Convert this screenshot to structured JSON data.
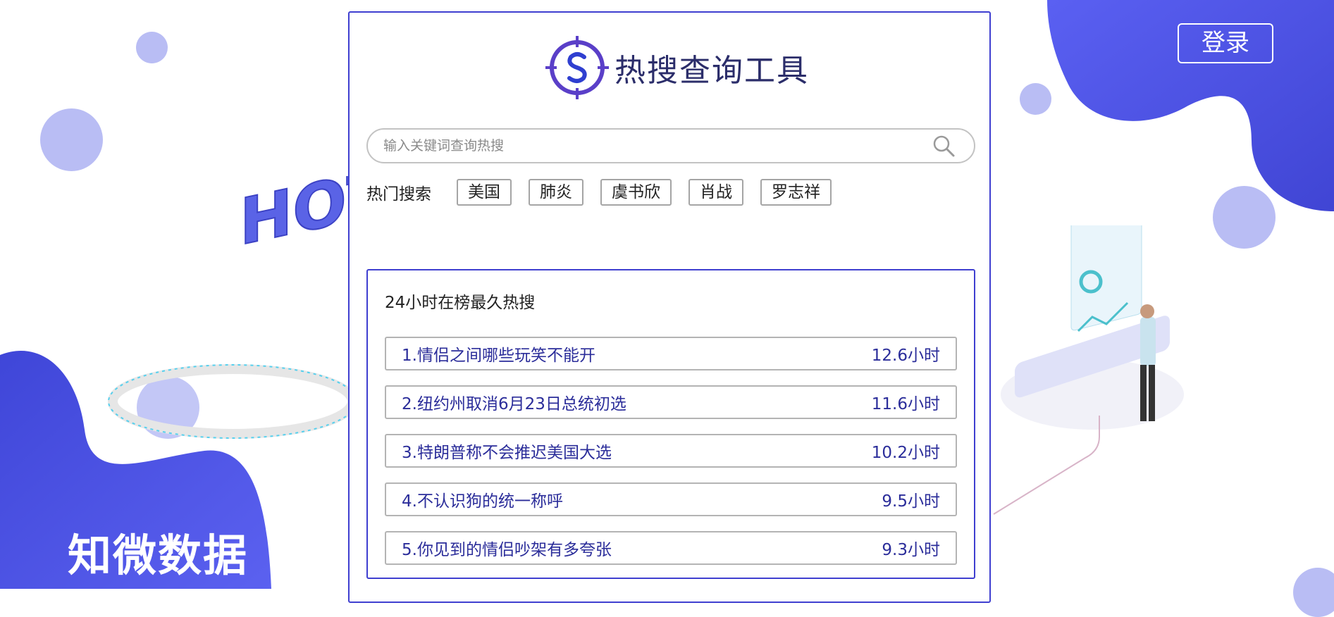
{
  "brand": {
    "name": "知微数据"
  },
  "header": {
    "login_label": "登录"
  },
  "logo": {
    "title": "热搜查询工具"
  },
  "search": {
    "placeholder": "输入关键词查询热搜"
  },
  "hot": {
    "label": "热门搜索",
    "tags": [
      "美国",
      "肺炎",
      "虞书欣",
      "肖战",
      "罗志祥"
    ]
  },
  "ranking": {
    "title": "24小时在榜最久热搜",
    "items": [
      {
        "text": "1.情侣之间哪些玩笑不能开",
        "duration": "12.6小时"
      },
      {
        "text": "2.纽约州取消6月23日总统初选",
        "duration": "11.6小时"
      },
      {
        "text": "3.特朗普称不会推迟美国大选",
        "duration": "10.2小时"
      },
      {
        "text": "4.不认识狗的统一称呼",
        "duration": "9.5小时"
      },
      {
        "text": "5.你见到的情侣吵架有多夸张",
        "duration": "9.3小时"
      }
    ]
  },
  "illustration": {
    "hot_text": "HOT SEARCH QUERY"
  },
  "colors": {
    "accent": "#4f56e8",
    "accent_dark": "#3f3fd0",
    "bubble": "#b9bdf4"
  },
  "icons": [
    "search-icon",
    "logo-compass-icon"
  ]
}
